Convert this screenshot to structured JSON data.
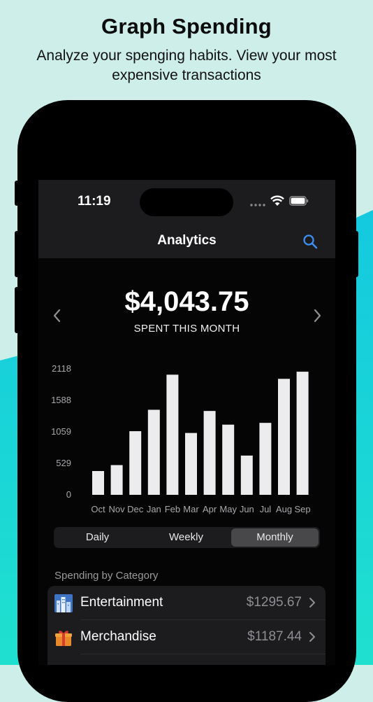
{
  "promo": {
    "title": "Graph Spending",
    "subtitle": "Analyze your spenging habits. View your most expensive transactions"
  },
  "colors": {
    "background_light": "#cdeee9",
    "background_wave": "#1fdcd6",
    "accent": "#3d8ff5",
    "bar": "#ececef"
  },
  "status_bar": {
    "time": "11:19"
  },
  "nav": {
    "title": "Analytics",
    "search_icon": "search-icon"
  },
  "summary": {
    "amount": "$4,043.75",
    "caption": "SPENT THIS MONTH",
    "prev_icon": "chevron-left-icon",
    "next_icon": "chevron-right-icon"
  },
  "chart_data": {
    "type": "bar",
    "categories": [
      "Oct",
      "Nov",
      "Dec",
      "Jan",
      "Feb",
      "Mar",
      "Apr",
      "May",
      "Jun",
      "Jul",
      "Aug",
      "Sep"
    ],
    "values": [
      400,
      500,
      1070,
      1430,
      2020,
      1040,
      1410,
      1180,
      660,
      1210,
      1950,
      2070
    ],
    "y_ticks": [
      "2118",
      "1588",
      "1059",
      "529",
      "0"
    ],
    "ylim": [
      0,
      2118
    ],
    "grid": false
  },
  "period_selector": {
    "options": [
      "Daily",
      "Weekly",
      "Monthly"
    ],
    "selected": "Monthly"
  },
  "categories": {
    "label": "Spending by Category",
    "items": [
      {
        "name": "Entertainment",
        "amount": "$1295.67",
        "icon": "city-icon"
      },
      {
        "name": "Merchandise",
        "amount": "$1187.44",
        "icon": "gift-icon"
      },
      {
        "name": "",
        "amount": "",
        "icon": "food-icon"
      }
    ]
  }
}
